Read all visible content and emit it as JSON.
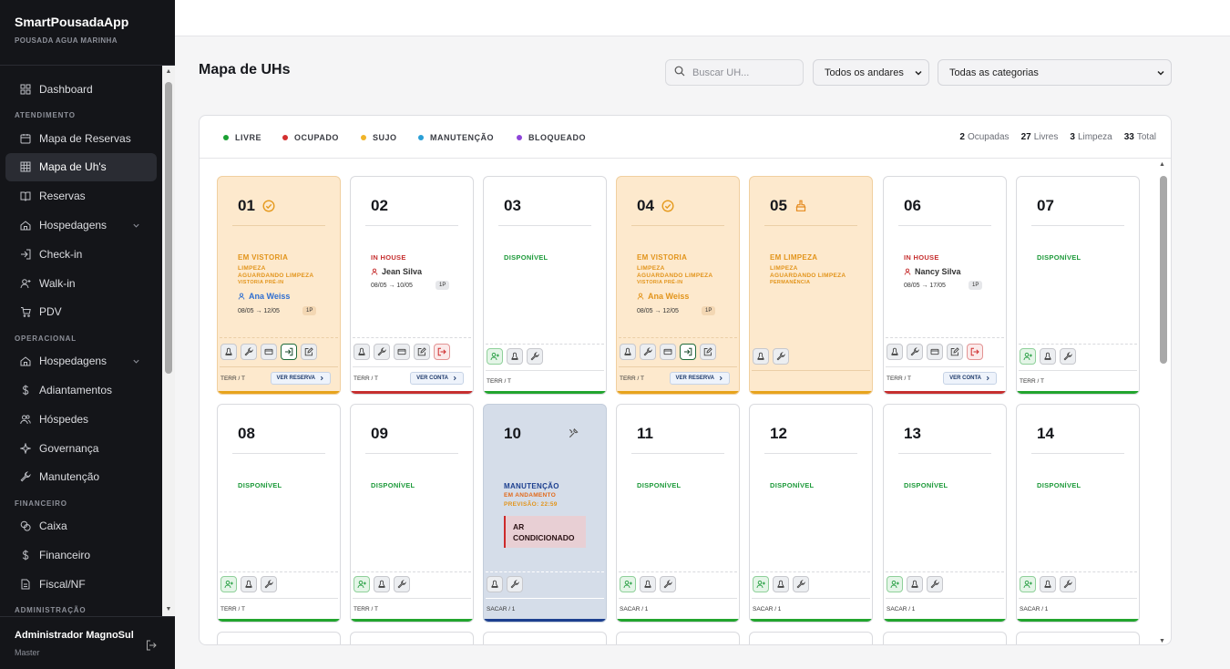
{
  "app": {
    "name": "SmartPousadaApp",
    "property": "POUSADA AGUA MARINHA"
  },
  "sidebar": {
    "dashboard": "Dashboard",
    "sections": {
      "atendimento": "ATENDIMENTO",
      "operacional": "OPERACIONAL",
      "financeiro": "FINANCEIRO",
      "administracao": "ADMINISTRAÇÃO"
    },
    "items": {
      "mapa_reservas": "Mapa de Reservas",
      "mapa_uhs": "Mapa de Uh's",
      "reservas": "Reservas",
      "hospedagens": "Hospedagens",
      "checkin": "Check-in",
      "walkin": "Walk-in",
      "pdv": "PDV",
      "hospedagens2": "Hospedagens",
      "adiantamentos": "Adiantamentos",
      "hospedes": "Hóspedes",
      "governanca": "Governança",
      "manutencao": "Manutenção",
      "caixa": "Caixa",
      "financeiro": "Financeiro",
      "fiscal": "Fiscal/NF"
    }
  },
  "user": {
    "name": "Administrador MagnoSul",
    "role": "Master"
  },
  "page": {
    "title": "Mapa de UHs",
    "search_placeholder": "Buscar UH...",
    "floor_filter": "Todos os andares",
    "category_filter": "Todas as categorias"
  },
  "legend": {
    "livre": "LIVRE",
    "ocupado": "OCUPADO",
    "sujo": "SUJO",
    "manutencao": "MANUTENÇÃO",
    "bloqueado": "BLOQUEADO"
  },
  "stats": {
    "ocupadas": "2",
    "ocupadas_label": "Ocupadas",
    "livres": "27",
    "livres_label": "Livres",
    "limpeza": "3",
    "limpeza_label": "Limpeza",
    "total": "33",
    "total_label": "Total"
  },
  "colors": {
    "livre": "#1aa033",
    "ocupado": "#d32f2f",
    "sujo": "#f0b429",
    "manutencao": "#2a9fd6",
    "bloqueado": "#8e44d9",
    "occupied_bar": "#c62f2f",
    "dirty_bar": "#e7a31c",
    "free_bar": "#22a52e",
    "maintenance_bar": "#1c3f8f"
  },
  "rooms": {
    "r01": {
      "number": "01",
      "status": "EM VISTORIA",
      "sub1": "LIMPEZA",
      "sub2": "AGUARDANDO LIMPEZA",
      "sub3": "VISTORIA PRÉ-IN",
      "guest": "Ana Weiss",
      "dates": "08/05 → 12/05",
      "pax": "1P",
      "floor": "TERR / T",
      "button": "VER RESERVA"
    },
    "r02": {
      "number": "02",
      "status": "IN HOUSE",
      "guest": "Jean Silva",
      "dates": "08/05 → 10/05",
      "pax": "1P",
      "floor": "TERR / T",
      "button": "VER CONTA"
    },
    "r03": {
      "number": "03",
      "status": "DISPONÍVEL",
      "floor": "TERR / T"
    },
    "r04": {
      "number": "04",
      "status": "EM VISTORIA",
      "sub1": "LIMPEZA",
      "sub2": "AGUARDANDO LIMPEZA",
      "sub3": "VISTORIA PRÉ-IN",
      "guest": "Ana Weiss",
      "dates": "08/05 → 12/05",
      "pax": "1P",
      "floor": "TERR / T",
      "button": "VER RESERVA"
    },
    "r05": {
      "number": "05",
      "status": "EM LIMPEZA",
      "sub1": "LIMPEZA",
      "sub2": "AGUARDANDO LIMPEZA",
      "sub3": "PERMANÊNCIA"
    },
    "r06": {
      "number": "06",
      "status": "IN HOUSE",
      "guest": "Nancy Silva",
      "dates": "08/05 → 17/05",
      "pax": "1P",
      "floor": "TERR / T",
      "button": "VER CONTA"
    },
    "r07": {
      "number": "07",
      "status": "DISPONÍVEL",
      "floor": "TERR / T"
    },
    "r08": {
      "number": "08",
      "status": "DISPONÍVEL",
      "floor": "TERR / T"
    },
    "r09": {
      "number": "09",
      "status": "DISPONÍVEL",
      "floor": "TERR / T"
    },
    "r10": {
      "number": "10",
      "status": "MANUTENÇÃO",
      "sub1": "EM ANDAMENTO",
      "sub2": "PREVISÃO: 22:59",
      "issue_line1": "AR",
      "issue_line2": "CONDICIONADO",
      "floor": "SACAR / 1"
    },
    "r11": {
      "number": "11",
      "status": "DISPONÍVEL",
      "floor": "SACAR / 1"
    },
    "r12": {
      "number": "12",
      "status": "DISPONÍVEL",
      "floor": "SACAR / 1"
    },
    "r13": {
      "number": "13",
      "status": "DISPONÍVEL",
      "floor": "SACAR / 1"
    },
    "r14": {
      "number": "14",
      "status": "DISPONÍVEL",
      "floor": "SACAR / 1"
    }
  }
}
